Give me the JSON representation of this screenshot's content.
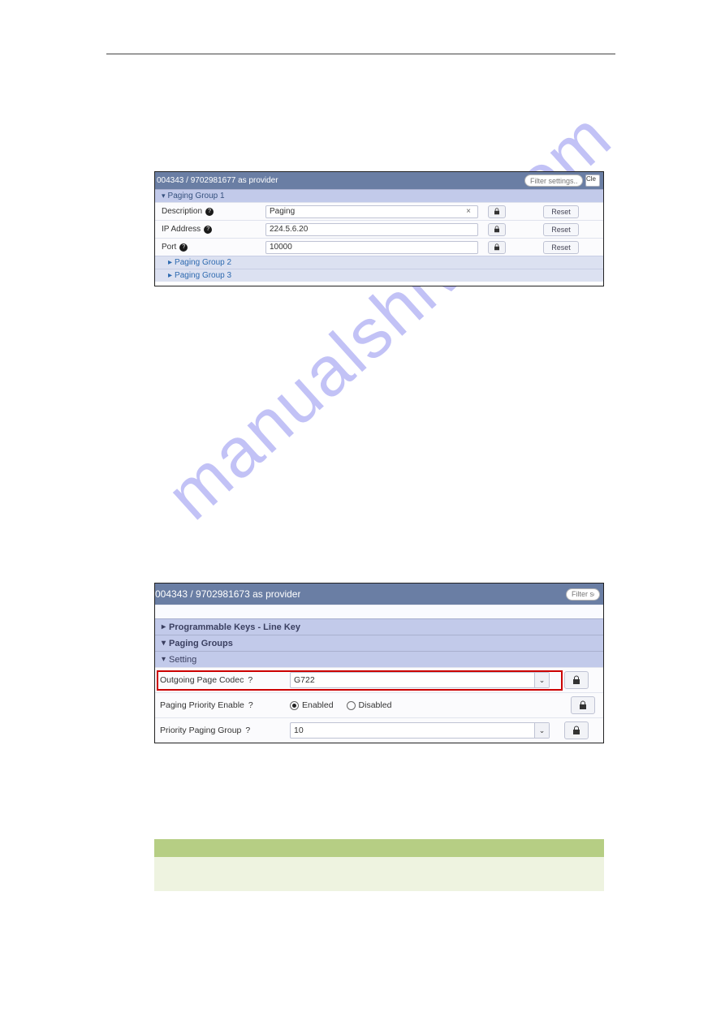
{
  "watermark": "manualshive.com",
  "panel1": {
    "header": "004343 / 9702981677 as provider",
    "filter_placeholder": "Filter settings...",
    "clear_label": "Cle",
    "group1_title": "Paging Group 1",
    "group2_title": "Paging Group 2",
    "group3_title": "Paging Group 3",
    "reset_label": "Reset",
    "rows": [
      {
        "label": "Description",
        "value": "Paging"
      },
      {
        "label": "IP Address",
        "value": "224.5.6.20"
      },
      {
        "label": "Port",
        "value": "10000"
      }
    ]
  },
  "panel2": {
    "header": "004343 / 9702981673 as provider",
    "filter_placeholder": "Filter settin",
    "sections": [
      "Programmable Keys - Line Key",
      "Paging Groups",
      "Setting"
    ],
    "rows": [
      {
        "label": "Outgoing Page Codec",
        "value": "G722"
      },
      {
        "label": "Paging Priority Enable",
        "options": [
          "Enabled",
          "Disabled"
        ],
        "selected": "Enabled"
      },
      {
        "label": "Priority Paging Group",
        "value": "10"
      }
    ]
  }
}
